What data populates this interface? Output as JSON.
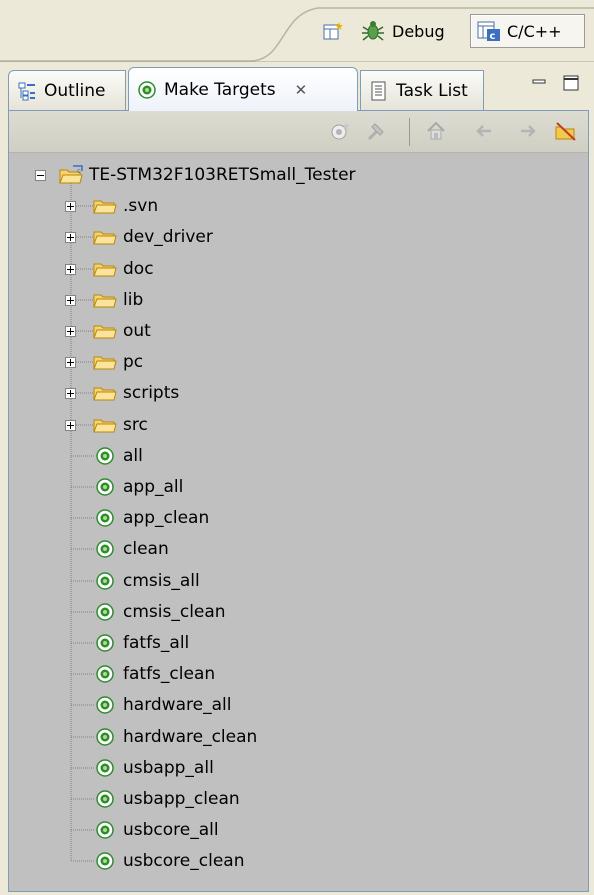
{
  "perspectives": {
    "debug_label": "Debug",
    "cpp_label": "C/C++"
  },
  "tabs": {
    "outline": "Outline",
    "make_targets": "Make Targets",
    "task_list": "Task List"
  },
  "tree": {
    "project": "TE-STM32F103RETSmall_Tester",
    "folders": [
      ".svn",
      "dev_driver",
      "doc",
      "lib",
      "out",
      "pc",
      "scripts",
      "src"
    ],
    "targets": [
      "all",
      "app_all",
      "app_clean",
      "clean",
      "cmsis_all",
      "cmsis_clean",
      "fatfs_all",
      "fatfs_clean",
      "hardware_all",
      "hardware_clean",
      "usbapp_all",
      "usbapp_clean",
      "usbcore_all",
      "usbcore_clean"
    ]
  },
  "colors": {
    "background": "#ece9d8",
    "tree_background": "#c0c0c0",
    "folder": "#f2c94c",
    "target_green": "#2e8b2e",
    "tab_border": "#7f9db9"
  },
  "icons": {
    "open_perspective": "open-perspective-icon",
    "debug": "bug-icon",
    "cpp": "cpp-perspective-icon",
    "outline": "outline-icon",
    "make_target": "make-target-icon",
    "task_list": "task-list-icon",
    "folder": "folder-icon",
    "project": "project-folder-icon"
  }
}
